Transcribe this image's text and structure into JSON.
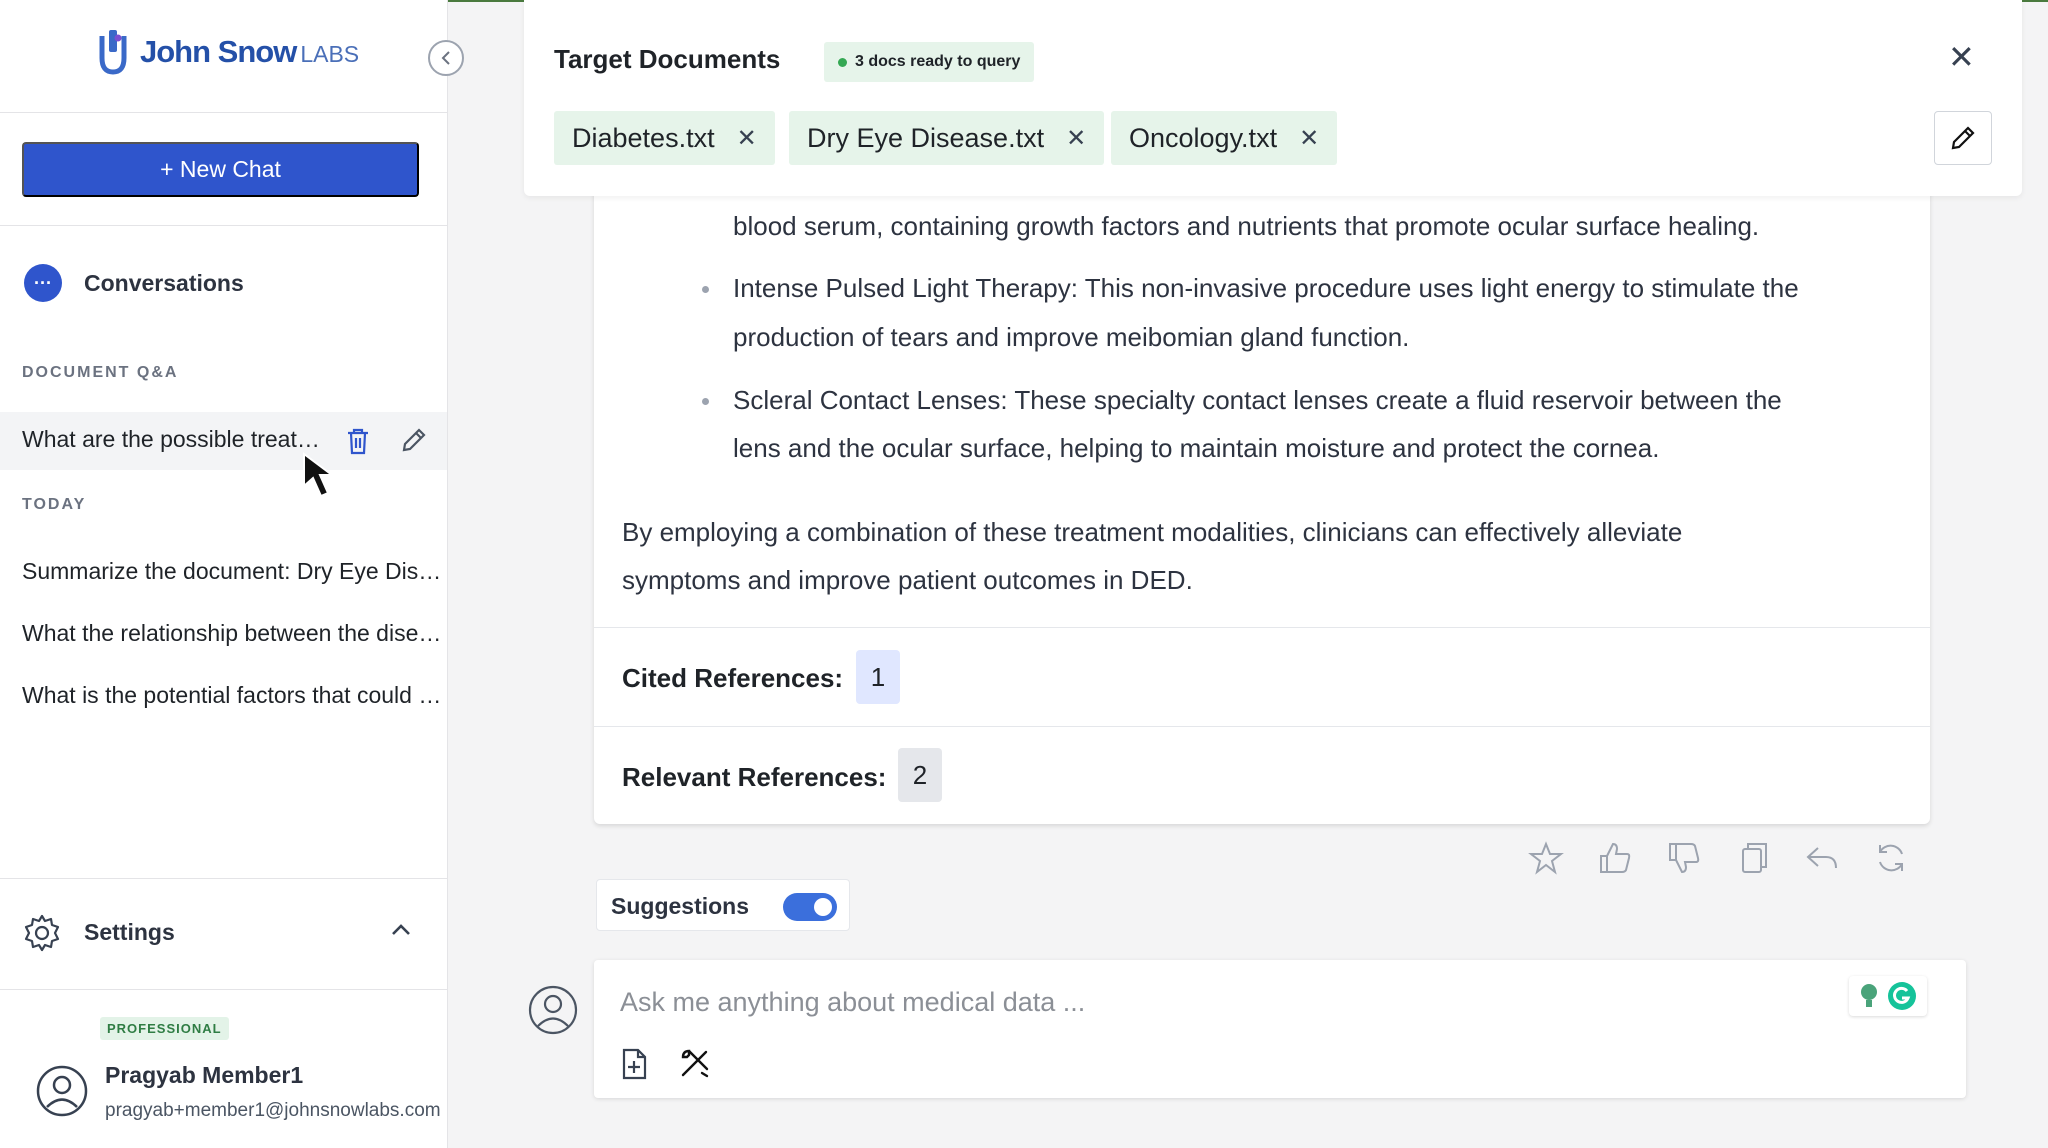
{
  "app": {
    "logo_name": "John Snow",
    "logo_suffix": "LABS"
  },
  "sidebar": {
    "new_chat_label": "+ New Chat",
    "conversations_label": "Conversations",
    "section_doc_qa": "DOCUMENT Q&A",
    "active_chat": "What are the possible treatment options for Dry Eye Disease?",
    "section_today": "TODAY",
    "today_chats": [
      "Summarize the document: Dry Eye Disease.txt",
      "What the relationship between the disease and treatments",
      "What is the potential factors that could lead to the disease"
    ],
    "settings_label": "Settings",
    "plan_badge": "PROFESSIONAL",
    "user_name": "Pragyab Member1",
    "user_email": "pragyab+member1@johnsnowlabs.com"
  },
  "target": {
    "title": "Target Documents",
    "status": "3 docs ready to query",
    "documents": [
      "Diabetes.txt",
      "Dry Eye Disease.txt",
      "Oncology.txt"
    ]
  },
  "response": {
    "lines": [
      "blood serum, containing growth factors and nutrients that promote ocular surface healing.",
      "Intense Pulsed Light Therapy: This non-invasive procedure uses light energy to stimulate the",
      "production of tears and improve meibomian gland function.",
      "Scleral Contact Lenses: These specialty contact lenses create a fluid reservoir between the",
      "lens and the ocular surface, helping to maintain moisture and protect the cornea.",
      "By employing a combination of these treatment modalities, clinicians can effectively alleviate",
      "symptoms and improve patient outcomes in DED."
    ],
    "cited_label": "Cited References:",
    "cited_count": "1",
    "relevant_label": "Relevant References:",
    "relevant_count": "2"
  },
  "suggestions": {
    "label": "Suggestions",
    "enabled": true
  },
  "input": {
    "placeholder": "Ask me anything about medical data ..."
  },
  "colors": {
    "primary": "#2f55cc",
    "chip_bg": "#e6f4ea",
    "cited_bg": "#e0e7ff",
    "relevant_bg": "#e5e7eb"
  }
}
